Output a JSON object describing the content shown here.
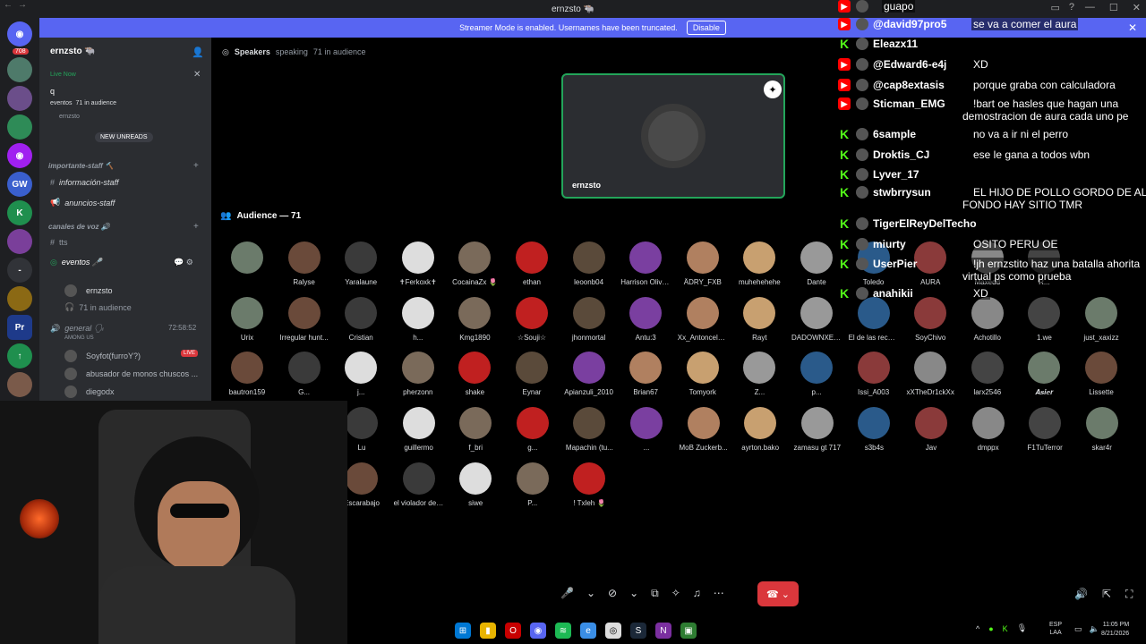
{
  "window": {
    "title": "ernzsto 🐃"
  },
  "banner": {
    "text": "Streamer Mode is enabled. Usernames have been truncated.",
    "button": "Disable"
  },
  "rail": {
    "badge": "708"
  },
  "sidebar": {
    "server_name": "ernzsto 🐃",
    "live_now": "Live Now",
    "search_value": "q",
    "live_event": "eventos",
    "live_audience": "71 in audience",
    "live_host": "ernzsto",
    "new_unreads": "NEW UNREADS",
    "cat_staff": "importante-staff 🔨",
    "ch_info": "información-staff",
    "ch_anuncios": "anuncios-staff",
    "cat_voz": "canales de voz 🔊",
    "ch_tts": "tts",
    "ch_eventos": "eventos 🎤",
    "eventos_host": "ernzsto",
    "eventos_audience": "71 in audience",
    "ch_general": "general 🗣",
    "general_time": "72:58:52",
    "general_activity": "AMONG US",
    "general_users": [
      "Soyfot(furroY?)",
      "abusador de monos chuscos ...",
      "diegodx"
    ],
    "live_badge": "LIVE"
  },
  "stage": {
    "header_speakers": "Speakers",
    "header_speaking": "speaking",
    "header_audience": "71 in audience",
    "speaker_name": "ernzsto",
    "audience_title": "Audience — 71"
  },
  "audience": [
    {
      "name": ""
    },
    {
      "name": "Ralyse"
    },
    {
      "name": "Yaralaune"
    },
    {
      "name": "✝Ferkoxk✝"
    },
    {
      "name": "CocainaZx 🌷"
    },
    {
      "name": "ethan"
    },
    {
      "name": "leoonb04"
    },
    {
      "name": "Harrison Olive..."
    },
    {
      "name": "ÅDRY_FXB"
    },
    {
      "name": "muhehehehe"
    },
    {
      "name": "Dante"
    },
    {
      "name": "Toledo"
    },
    {
      "name": "AURA"
    },
    {
      "name": "Maxedd"
    },
    {
      "name": "R..."
    },
    {
      "name": "Urix"
    },
    {
      "name": "Irregular hunt..."
    },
    {
      "name": "Cristian"
    },
    {
      "name": "h..."
    },
    {
      "name": "Kmg1890"
    },
    {
      "name": "☆Souji☆"
    },
    {
      "name": "jhonmortal"
    },
    {
      "name": "Antu:3"
    },
    {
      "name": "Xx_Antoncel2..."
    },
    {
      "name": "Rayt"
    },
    {
      "name": "DADOWNXEN..."
    },
    {
      "name": "El de las recar..."
    },
    {
      "name": "SoyChivo"
    },
    {
      "name": "Achotillo"
    },
    {
      "name": "1.we"
    },
    {
      "name": "just_xaxizz"
    },
    {
      "name": "bautron159"
    },
    {
      "name": "G..."
    },
    {
      "name": "j..."
    },
    {
      "name": "pherzonn"
    },
    {
      "name": "shake"
    },
    {
      "name": "Eynar"
    },
    {
      "name": "Apianzuli_2010"
    },
    {
      "name": "Brian67"
    },
    {
      "name": "Tomyork"
    },
    {
      "name": "Z..."
    },
    {
      "name": "p..."
    },
    {
      "name": "Issi_A003"
    },
    {
      "name": "xXTheDr1ckXx"
    },
    {
      "name": "larx2546"
    },
    {
      "name": "𝑨𝒔𝒊𝒆𝒓"
    },
    {
      "name": "Lissette"
    },
    {
      "name": "Lu"
    },
    {
      "name": "guillermo"
    },
    {
      "name": "f_bri"
    },
    {
      "name": "g..."
    },
    {
      "name": "Mapachin (tu..."
    },
    {
      "name": "..."
    },
    {
      "name": "MoB Zuckerb..."
    },
    {
      "name": "ayrton.bako"
    },
    {
      "name": "zamasu gt 717"
    },
    {
      "name": "s3b4s"
    },
    {
      "name": "Jav"
    },
    {
      "name": "dmppx"
    },
    {
      "name": "F1TuTerror"
    },
    {
      "name": "skar4r"
    },
    {
      "name": "Escarabajo"
    },
    {
      "name": "el violador de ..."
    },
    {
      "name": "siwe"
    },
    {
      "name": "P..."
    },
    {
      "name": "! Txleh 🌷"
    }
  ],
  "chat": [
    {
      "platform": "yt",
      "user": "",
      "text": "guapo"
    },
    {
      "platform": "yt",
      "user": "@david97pro5",
      "text": "se va a comer el aura"
    },
    {
      "platform": "kk",
      "user": "Eleazx11",
      "text": ""
    },
    {
      "platform": "yt",
      "user": "@Edward6-e4j",
      "text": "XD"
    },
    {
      "platform": "yt",
      "user": "@cap8extasis",
      "text": "porque graba con calculadora"
    },
    {
      "platform": "yt",
      "user": "Sticman_EMG",
      "text": "!bart oe hasles que hagan una"
    },
    {
      "platform": "none",
      "user": "",
      "text": "demostracion de aura cada uno pe"
    },
    {
      "platform": "kk",
      "user": "6sample",
      "text": "no va a ir ni el perro"
    },
    {
      "platform": "kk",
      "user": "Droktis_CJ",
      "text": "ese le gana a todos wbn"
    },
    {
      "platform": "kk",
      "user": "Lyver_17",
      "text": ""
    },
    {
      "platform": "kk",
      "user": "stwbrrysun",
      "text": "EL HIJO DE POLLO GORDO DE AL"
    },
    {
      "platform": "none",
      "user": "",
      "text": "FONDO HAY SITIO TMR"
    },
    {
      "platform": "kk",
      "user": "TigerElReyDelTecho",
      "text": ""
    },
    {
      "platform": "kk",
      "user": "miurty",
      "text": "OSITO PERU OE"
    },
    {
      "platform": "kk",
      "user": "UserPier",
      "text": "!jh ernzstito haz una batalla ahorita"
    },
    {
      "platform": "none",
      "user": "",
      "text": "virtual ps como prueba"
    },
    {
      "platform": "kk",
      "user": "anahikii",
      "text": "XD"
    }
  ],
  "taskbar": {
    "lang": "ESP",
    "lang2": "LAA",
    "time": "11:05 PM",
    "date": "8/21/2026"
  },
  "colors": {
    "blurple": "#5865f2",
    "kick_green": "#53fc18",
    "youtube_red": "#ff0000",
    "end_call": "#da373c"
  }
}
